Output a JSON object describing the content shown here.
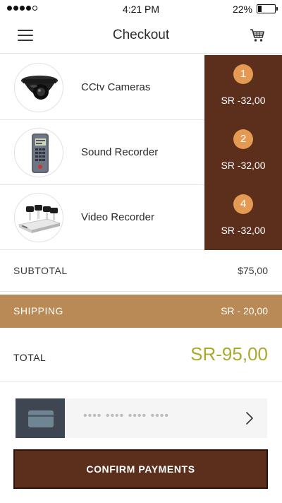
{
  "status_bar": {
    "time": "4:21 PM",
    "battery_percent": "22%",
    "battery_level": 0.22,
    "signal_bars": 4,
    "signal_total": 5
  },
  "nav": {
    "title": "Checkout",
    "menu_icon": "hamburger-menu-icon",
    "cart_icon": "shopping-cart-icon"
  },
  "items": [
    {
      "name": "CCtv Cameras",
      "quantity": "1",
      "price": "SR -32,00",
      "icon": "dome-camera-icon"
    },
    {
      "name": "Sound Recorder",
      "quantity": "2",
      "price": "SR -32,00",
      "icon": "voice-recorder-icon"
    },
    {
      "name": "Video Recorder",
      "quantity": "4",
      "price": "SR -32,00",
      "icon": "dvr-kit-icon"
    }
  ],
  "summary": {
    "subtotal_label": "SUBTOTAL",
    "subtotal_value": "$75,00",
    "shipping_label": "SHIPPING",
    "shipping_value": "SR - 20,00",
    "total_label": "TOTAL",
    "total_value": "SR-95,00"
  },
  "payment": {
    "card_number_masked": "•••• •••• •••• ••••",
    "card_icon": "credit-card-icon",
    "chevron_icon": "chevron-right-icon"
  },
  "confirm_button": "CONFIRM PAYMENTS",
  "colors": {
    "brown": "#5c2e1c",
    "badge": "#e49a52",
    "shipping_bar": "#b98a55",
    "total_accent": "#a9ab2c",
    "card_box": "#3d4651"
  }
}
